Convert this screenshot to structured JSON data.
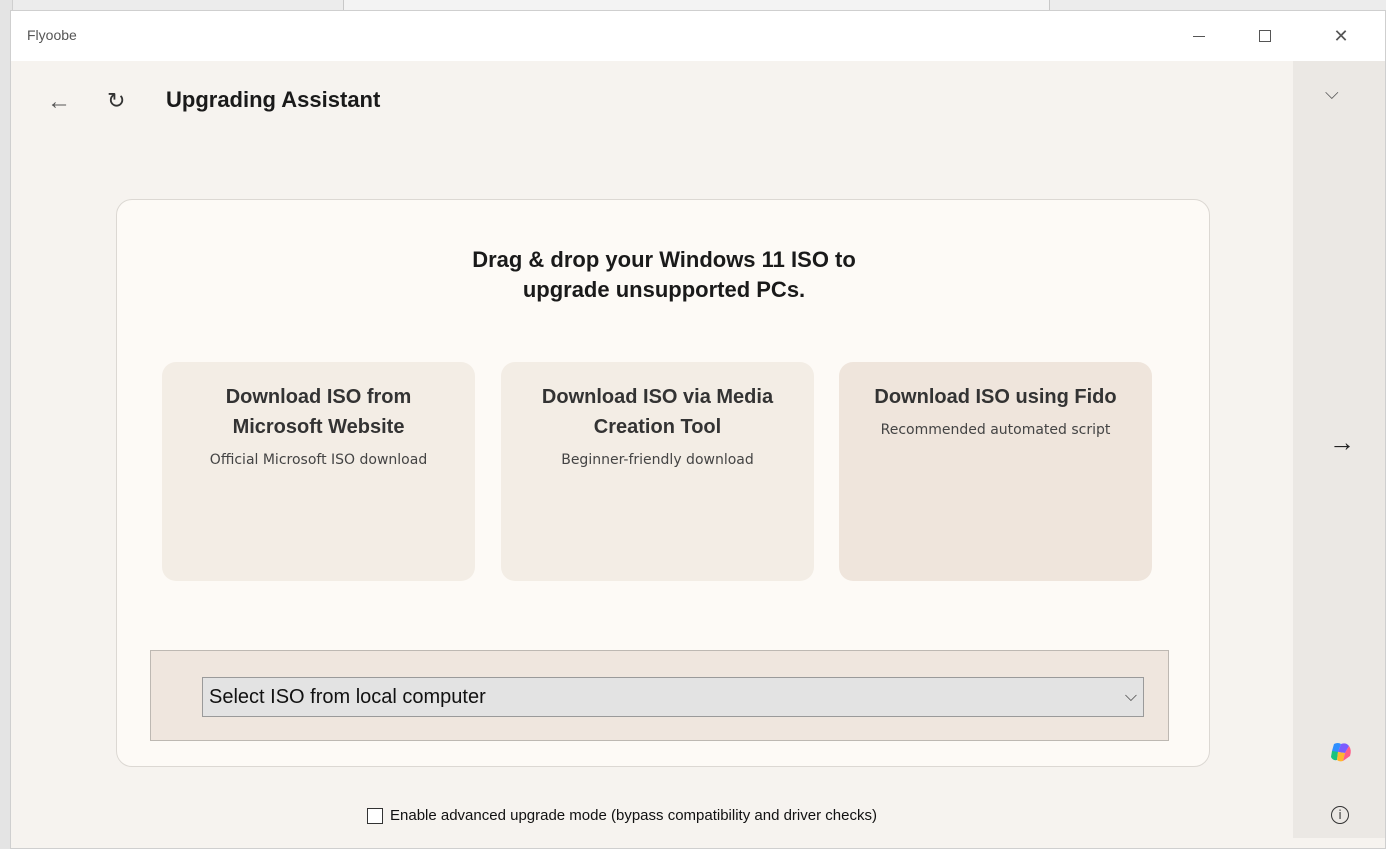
{
  "window": {
    "title": "Flyoobe",
    "minimize_icon": "minimize-icon",
    "maximize_icon": "maximize-icon",
    "close_glyph": "✕"
  },
  "nav": {
    "back_glyph": "←",
    "refresh_glyph": "↻",
    "page_title": "Upgrading Assistant"
  },
  "card": {
    "headline_line1": "Drag & drop your Windows 11 ISO to",
    "headline_line2": "upgrade unsupported PCs.",
    "options": [
      {
        "title": "Download ISO from Microsoft Website",
        "subtitle": "Official Microsoft ISO download"
      },
      {
        "title": "Download ISO via Media Creation Tool",
        "subtitle": "Beginner-friendly download"
      },
      {
        "title": "Download ISO using Fido",
        "subtitle": "Recommended automated script"
      }
    ],
    "select": {
      "value": "Select ISO from local computer",
      "chevron_glyph": "⌵"
    }
  },
  "advanced": {
    "checked": false,
    "label": "Enable advanced upgrade mode (bypass compatibility and driver checks)"
  },
  "right_pane": {
    "collapse_glyph": "⌵",
    "next_glyph": "→",
    "info_glyph": "i",
    "copilot_icon": "copilot-icon"
  },
  "colors": {
    "window_bg": "#f6f3ef",
    "card_bg": "#fdfaf6",
    "option_bg": "#f3ede5",
    "option_highlight_bg": "#efe5dc",
    "right_pane_bg": "#ebe8e4"
  }
}
